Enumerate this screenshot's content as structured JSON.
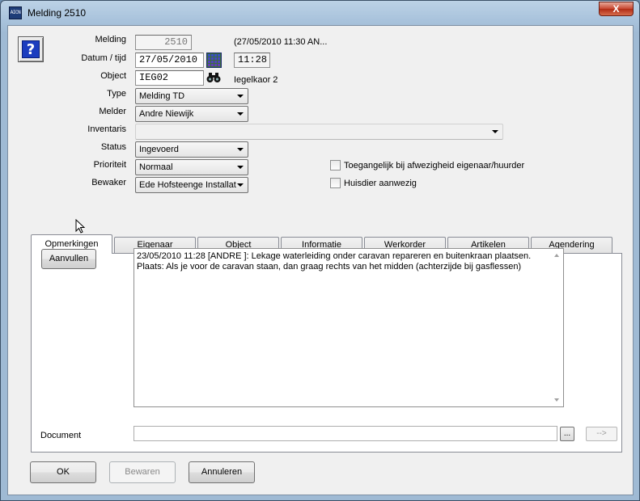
{
  "window": {
    "title": "Melding 2510",
    "icon": "app-icon",
    "icon_text": "AICN",
    "close_label": "X"
  },
  "help": {
    "glyph": "?"
  },
  "form": {
    "melding": {
      "label": "Melding",
      "value": "2510"
    },
    "created_info": "(27/05/2010 11:30 AN...",
    "datum": {
      "label": "Datum / tijd",
      "date": "27/05/2010",
      "time": "11:28"
    },
    "object": {
      "label": "Object",
      "value": "IEG02",
      "description": "Iegelkaor 2"
    },
    "type": {
      "label": "Type",
      "value": "Melding TD"
    },
    "melder": {
      "label": "Melder",
      "value": "Andre Niewijk"
    },
    "inventaris": {
      "label": "Inventaris",
      "value": ""
    },
    "status": {
      "label": "Status",
      "value": "Ingevoerd"
    },
    "prioriteit": {
      "label": "Prioriteit",
      "value": "Normaal"
    },
    "bewaker": {
      "label": "Bewaker",
      "value": "Ede Hofsteenge Installat"
    },
    "checkbox_toegang": {
      "label": "Toegangelijk bij afwezigheid eigenaar/huurder",
      "checked": false
    },
    "checkbox_huisdier": {
      "label": "Huisdier aanwezig",
      "checked": false
    }
  },
  "tabs": [
    {
      "label": "Opmerkingen",
      "active": true
    },
    {
      "label": "Eigenaar",
      "active": false
    },
    {
      "label": "Object",
      "active": false
    },
    {
      "label": "Informatie",
      "active": false
    },
    {
      "label": "Werkorder",
      "active": false
    },
    {
      "label": "Artikelen",
      "active": false
    },
    {
      "label": "Agendering",
      "active": false
    }
  ],
  "opmerkingen": {
    "aanvullen_label": "Aanvullen",
    "lines": [
      "23/05/2010 11:28 [ANDRE     ]: Lekage waterleiding onder caravan repareren en buitenkraan plaatsen.",
      "Plaats: Als je voor de caravan staan, dan graag rechts van het midden (achterzijde bij gasflessen)"
    ]
  },
  "document": {
    "label": "Document",
    "value": "",
    "browse_label": "...",
    "go_label": "-->"
  },
  "buttons": {
    "ok": "OK",
    "bewaren": "Bewaren",
    "annuleren": "Annuleren"
  },
  "colors": {
    "help_blue": "#1c3dbf",
    "close_red": "#c7452e",
    "title_bar": "#a9c3dc"
  }
}
